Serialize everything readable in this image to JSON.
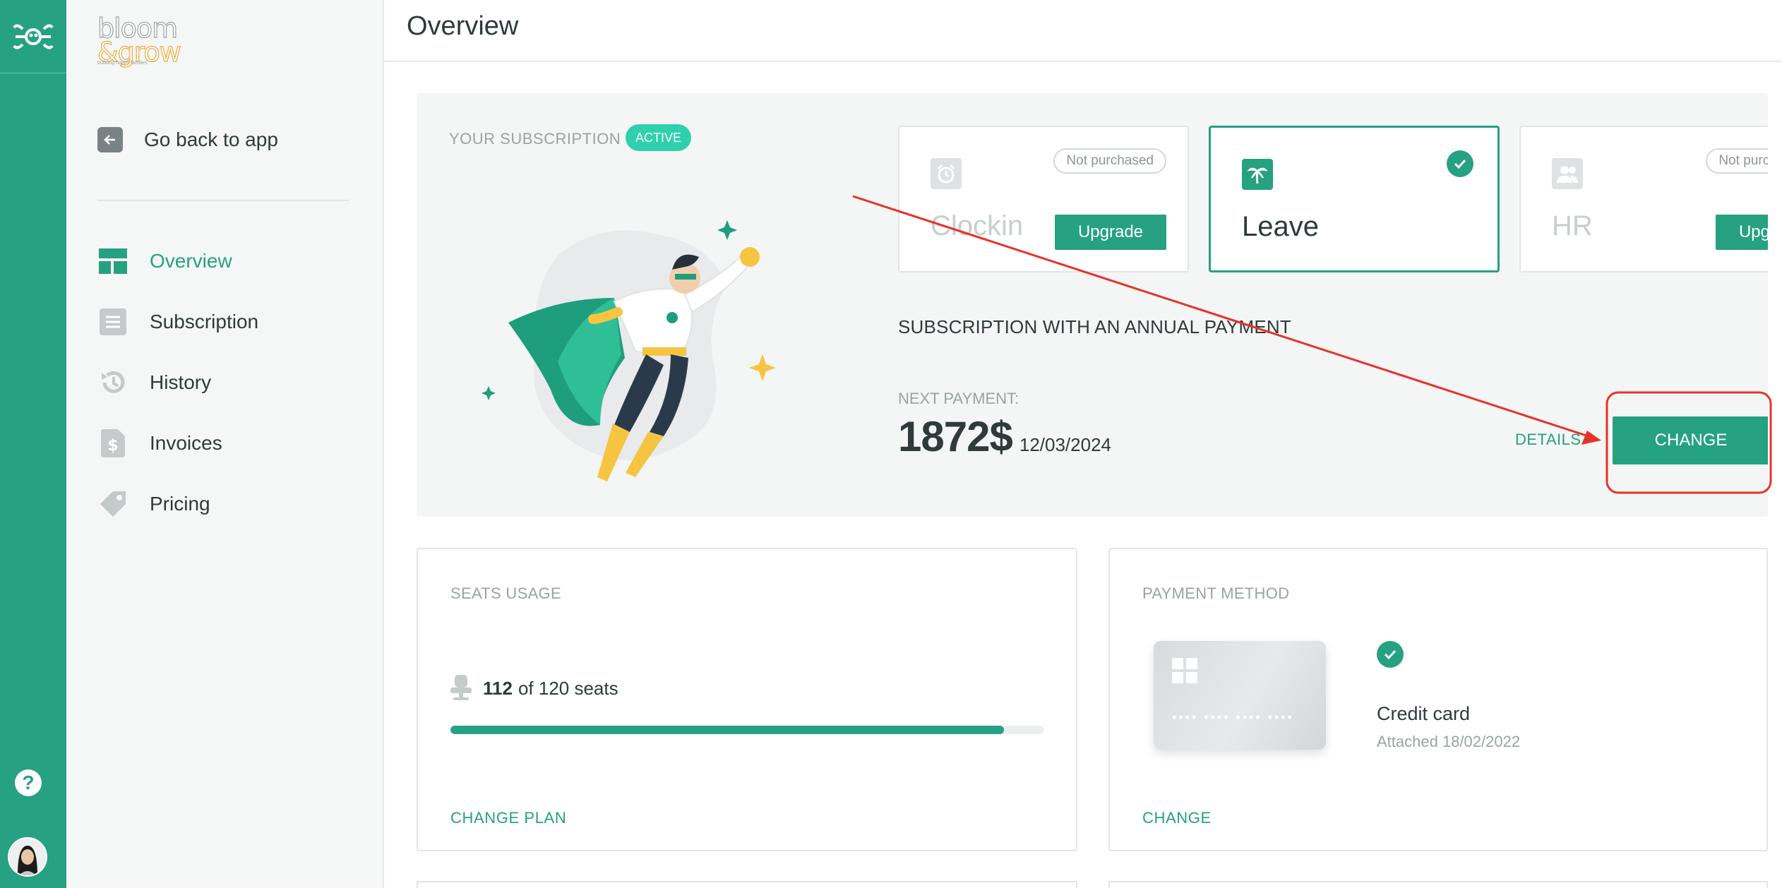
{
  "header": {
    "title": "Overview"
  },
  "sidebar": {
    "brand": {
      "line1": "bloom",
      "line2": "&grow",
      "tagline": "building happy families"
    },
    "back_label": "Go back to app",
    "items": [
      {
        "label": "Overview",
        "icon": "dashboard-icon",
        "active": true
      },
      {
        "label": "Subscription",
        "icon": "list-icon",
        "active": false
      },
      {
        "label": "History",
        "icon": "history-icon",
        "active": false
      },
      {
        "label": "Invoices",
        "icon": "dollar-document-icon",
        "active": false
      },
      {
        "label": "Pricing",
        "icon": "tag-icon",
        "active": false
      }
    ]
  },
  "rail": {
    "help": "?"
  },
  "subscription": {
    "label": "YOUR SUBSCRIPTION",
    "status": "ACTIVE",
    "tiles": [
      {
        "name": "Clockin",
        "badge": "Not purchased",
        "button": "Upgrade",
        "icon": "alarm-clock-icon",
        "selected": false
      },
      {
        "name": "Leave",
        "icon": "palm-tree-icon",
        "selected": true
      },
      {
        "name": "HR",
        "badge": "Not purchased",
        "button": "Upgrade",
        "icon": "people-icon",
        "selected": false
      }
    ],
    "plan": "SUBSCRIPTION WITH AN ANNUAL PAYMENT",
    "next_payment_label": "NEXT PAYMENT:",
    "amount": "1872$",
    "date": "12/03/2024",
    "details_label": "DETAILS",
    "change_label": "CHANGE"
  },
  "seats": {
    "title": "SEATS USAGE",
    "used": "112",
    "of_text": "of 120 seats",
    "progress": 0.933,
    "link": "CHANGE PLAN"
  },
  "payment": {
    "title": "PAYMENT METHOD",
    "card_mask": "•••• •••• •••• ••••",
    "name": "Credit card",
    "attached": "Attached 18/02/2022",
    "link": "CHANGE"
  },
  "colors": {
    "brand": "#26a181",
    "badge": "#2fd0ad",
    "annotation": "#e63329"
  }
}
